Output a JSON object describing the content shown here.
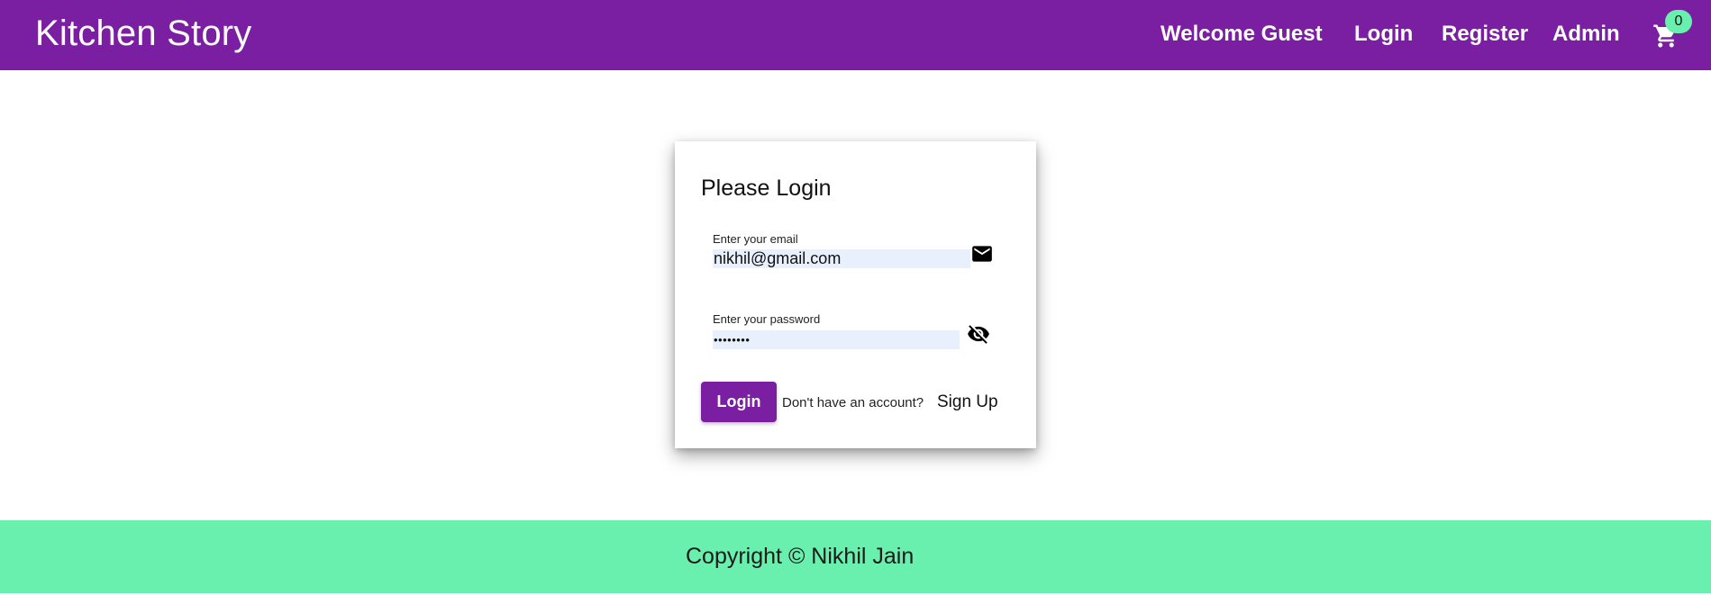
{
  "header": {
    "brand": "Kitchen Story",
    "nav": {
      "welcome": "Welcome Guest",
      "login": "Login",
      "register": "Register",
      "admin": "Admin"
    },
    "cart": {
      "icon": "shopping-cart-icon",
      "count": "0",
      "badge_color": "#69f0ae"
    },
    "background_color": "#7b1fa2"
  },
  "login_card": {
    "title": "Please Login",
    "email": {
      "label": "Enter your email",
      "value": "nikhil@gmail.com",
      "icon": "mail-icon"
    },
    "password": {
      "label": "Enter your password",
      "value": "••••••••",
      "icon": "eye-off-icon"
    },
    "login_button": "Login",
    "no_account_text": "Don't have an account?",
    "signup_link": "Sign Up"
  },
  "footer": {
    "text": "Copyright © Nikhil Jain",
    "background_color": "#69f0ae"
  }
}
